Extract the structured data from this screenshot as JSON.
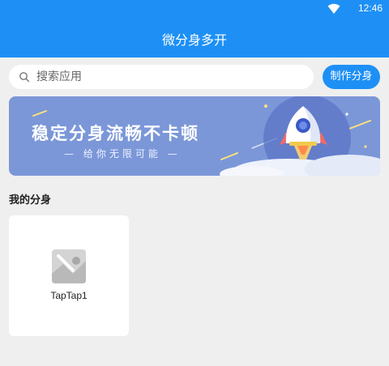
{
  "status_bar": {
    "time": "12:46",
    "wifi_icon": "wifi-icon"
  },
  "app_bar": {
    "title": "微分身多开"
  },
  "search": {
    "placeholder": "搜索应用",
    "icon": "search-icon"
  },
  "actions": {
    "make_clone_label": "制作分身"
  },
  "banner": {
    "headline": "稳定分身流畅不卡顿",
    "subline": "— 给你无限可能 —",
    "illustration": "rocket-illustration"
  },
  "section": {
    "title": "我的分身"
  },
  "clones": [
    {
      "name": "TapTap1",
      "icon": "app-placeholder-icon"
    }
  ],
  "colors": {
    "primary": "#1e90f5",
    "banner": "#7b97d8",
    "background": "#efefef"
  }
}
